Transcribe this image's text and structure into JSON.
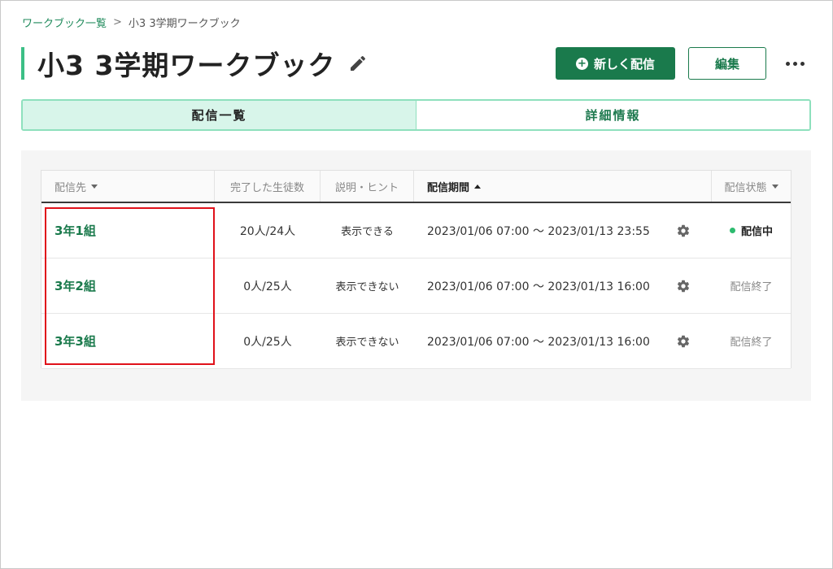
{
  "breadcrumb": {
    "parent": "ワークブック一覧",
    "separator": ">",
    "current": "小3 3学期ワークブック"
  },
  "header": {
    "title": "小3 3学期ワークブック",
    "new_button": "新しく配信",
    "edit_button": "編集"
  },
  "tabs": [
    {
      "label": "配信一覧",
      "active": true
    },
    {
      "label": "詳細情報",
      "active": false
    }
  ],
  "table": {
    "columns": {
      "destination": "配信先",
      "completed": "完了した生徒数",
      "hints": "説明・ヒント",
      "period": "配信期間",
      "status": "配信状態"
    },
    "rows": [
      {
        "destination": "3年1組",
        "completed": "20人/24人",
        "hints": "表示できる",
        "period": "2023/01/06 07:00 〜 2023/01/13 23:55",
        "status": "配信中"
      },
      {
        "destination": "3年2組",
        "completed": "0人/25人",
        "hints": "表示できない",
        "period": "2023/01/06 07:00 〜 2023/01/13 16:00",
        "status": "配信終了"
      },
      {
        "destination": "3年3組",
        "completed": "0人/25人",
        "hints": "表示できない",
        "period": "2023/01/06 07:00 〜 2023/01/13 16:00",
        "status": "配信終了"
      }
    ]
  },
  "colors": {
    "brand": "#1a7a4c",
    "accent": "#3cbf86",
    "highlight": "#e0111a"
  }
}
